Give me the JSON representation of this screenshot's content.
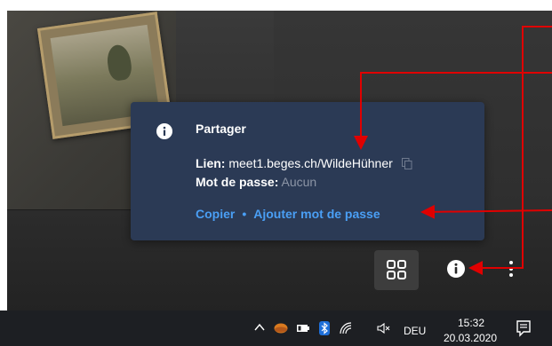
{
  "popup": {
    "title": "Partager",
    "link_label": "Lien:",
    "link_value": "meet1.beges.ch/WildeHühner",
    "password_label": "Mot de passe:",
    "password_value": "Aucun",
    "copy_action": "Copier",
    "separator": "•",
    "add_password_action": "Ajouter mot de passe",
    "accent_color": "#4a9ff5",
    "background_color": "#2b3a55"
  },
  "controls": {
    "grid_icon": "tile-view-icon",
    "info_icon": "info-icon",
    "more_icon": "more-vertical-icon"
  },
  "annotations": {
    "arrow_color": "#e00000"
  },
  "taskbar": {
    "tray_icons": [
      "chevron-up-icon",
      "app-icon",
      "battery-icon",
      "bluetooth-icon",
      "network-icon",
      "volume-muted-icon"
    ],
    "language": "DEU",
    "time": "15:32",
    "date": "20.03.2020",
    "notifications_icon": "action-center-icon"
  }
}
